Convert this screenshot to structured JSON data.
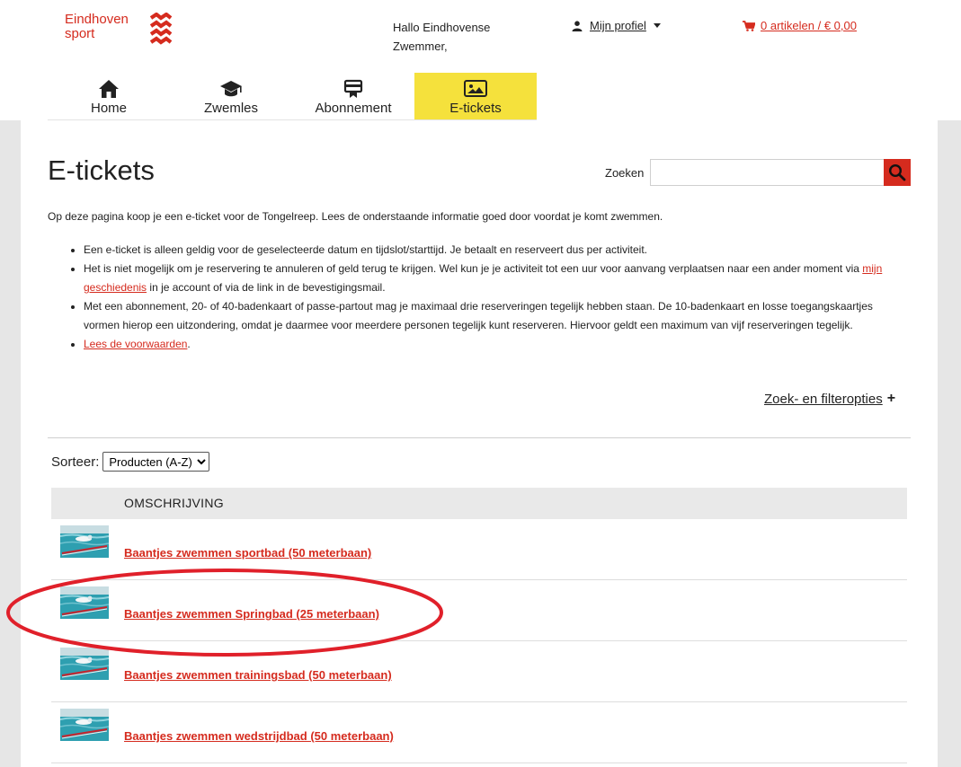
{
  "brand": {
    "line1": "Eindhoven",
    "line2": "sport",
    "accent": "#d52b1e",
    "nav_active": "#f5e13c"
  },
  "header": {
    "greeting": "Hallo Eindhovense Zwemmer,",
    "profile_label": "Mijn profiel",
    "cart_label": "0 artikelen / € 0,00"
  },
  "nav": {
    "items": [
      {
        "label": "Home",
        "icon": "home-icon"
      },
      {
        "label": "Zwemles",
        "icon": "graduation-cap-icon"
      },
      {
        "label": "Abonnement",
        "icon": "card-icon"
      },
      {
        "label": "E-tickets",
        "icon": "image-icon",
        "active": true
      }
    ]
  },
  "page": {
    "title": "E-tickets",
    "search_label": "Zoeken",
    "search_value": "",
    "intro": "Op deze pagina koop je een e-ticket voor de Tongelreep.  Lees de onderstaande informatie goed door voordat je komt zwemmen.",
    "bullets": {
      "b1": "Een e-ticket is alleen geldig voor de geselecteerde datum en tijdslot/starttijd. Je betaalt en reserveert dus per activiteit.",
      "b2_pre": "Het is niet mogelijk om je reservering te annuleren of geld terug te krijgen. Wel kun je je activiteit tot een uur voor aanvang verplaatsen naar een ander moment via ",
      "b2_link": "mijn geschiedenis",
      "b2_post": " in je account of via de link in de bevestigingsmail.",
      "b3": "Met een abonnement, 20- of 40-badenkaart of passe-partout mag je maximaal drie reserveringen tegelijk hebben staan. De 10-badenkaart en losse toegangskaartjes vormen hierop een uitzondering, omdat je daarmee voor meerdere personen tegelijk kunt reserveren. Hiervoor geldt een maximum van vijf reserveringen tegelijk.",
      "b4_link": "Lees de voorwaarden",
      "b4_post": "."
    },
    "filter_label": "Zoek- en filteropties",
    "filter_plus": "+",
    "sort_label": "Sorteer:",
    "sort_selected": "Producten (A-Z)",
    "column_header": "OMSCHRIJVING",
    "products": [
      {
        "title": "Baantjes zwemmen sportbad (50 meterbaan)"
      },
      {
        "title": "Baantjes zwemmen Springbad (25 meterbaan)",
        "highlighted": true
      },
      {
        "title": "Baantjes zwemmen trainingsbad (50 meterbaan)"
      },
      {
        "title": "Baantjes zwemmen wedstrijdbad (50 meterbaan)"
      }
    ]
  }
}
